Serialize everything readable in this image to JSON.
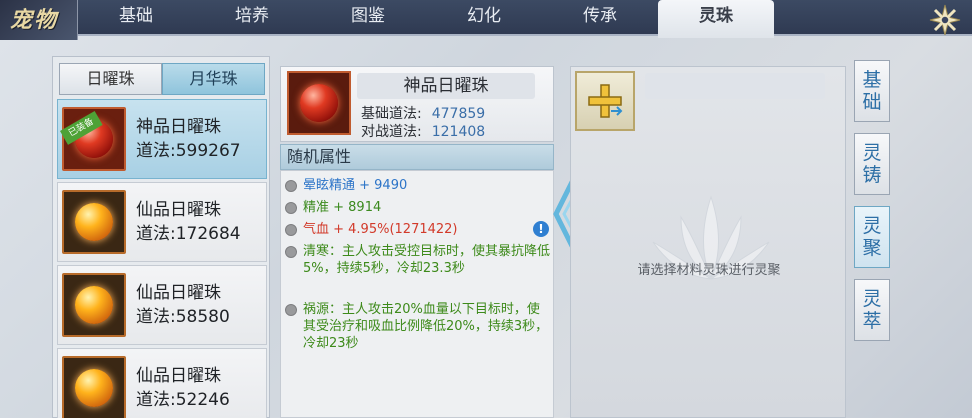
{
  "logo": {
    "text": "宠物"
  },
  "nav": {
    "tabs": [
      {
        "label": "基础"
      },
      {
        "label": "培养"
      },
      {
        "label": "图鉴"
      },
      {
        "label": "幻化"
      },
      {
        "label": "传承"
      },
      {
        "label": "灵珠"
      }
    ],
    "active_tab": "灵珠"
  },
  "left": {
    "segments": [
      {
        "label": "日曜珠"
      },
      {
        "label": "月华珠"
      }
    ],
    "active_segment": "月华珠",
    "pearls": [
      {
        "name": "神品日曜珠",
        "dao": "道法:599267",
        "badge": "已装备",
        "color": "red",
        "selected": true
      },
      {
        "name": "仙品日曜珠",
        "dao": "道法:172684",
        "color": "orange"
      },
      {
        "name": "仙品日曜珠",
        "dao": "道法:58580",
        "color": "orange"
      },
      {
        "name": "仙品日曜珠",
        "dao": "道法:52246",
        "color": "orange"
      }
    ]
  },
  "detail": {
    "name": "神品日曜珠",
    "base_label": "基础道法:",
    "base_value": "477859",
    "battle_label": "对战道法:",
    "battle_value": "121408",
    "attr_title": "随机属性",
    "attrs": [
      {
        "text": "晕眩精通 + 9490",
        "color": "blue"
      },
      {
        "text": "精准 + 8914",
        "color": "green"
      },
      {
        "text": "气血 + 4.95%(1271422)",
        "color": "red"
      },
      {
        "text": "清寒：主人攻击受控目标时，使其暴抗降低5%，持续5秒，冷却23.3秒",
        "color": "greentext"
      },
      {
        "text": "祸源：主人攻击20%血量以下目标时，使其受治疗和吸血比例降低20%，持续3秒，冷却23秒",
        "color": "greentext"
      }
    ],
    "info_icon": "!"
  },
  "fuse": {
    "hint": "请选择材料灵珠进行灵聚"
  },
  "side": {
    "buttons": [
      {
        "label_a": "基",
        "label_b": "础"
      },
      {
        "label_a": "灵",
        "label_b": "铸"
      },
      {
        "label_a": "灵",
        "label_b": "聚"
      },
      {
        "label_a": "灵",
        "label_b": "萃"
      }
    ],
    "active": 2
  },
  "colors": {
    "accent": "#8fc4dc",
    "blue": "#2c74c8",
    "green": "#3b8a1e",
    "red": "#d23a2a"
  }
}
